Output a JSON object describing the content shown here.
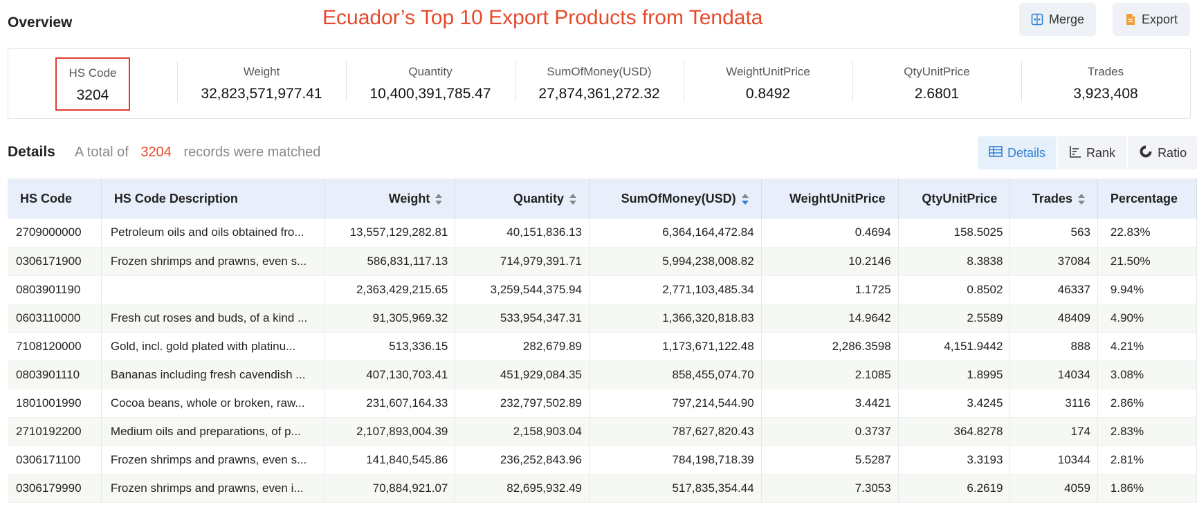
{
  "header": {
    "overview_title": "Overview",
    "banner": "Ecuador’s Top 10 Export Products from Tendata",
    "merge_label": "Merge",
    "export_label": "Export"
  },
  "summary": [
    {
      "label": "HS Code",
      "value": "3204"
    },
    {
      "label": "Weight",
      "value": "32,823,571,977.41"
    },
    {
      "label": "Quantity",
      "value": "10,400,391,785.47"
    },
    {
      "label": "SumOfMoney(USD)",
      "value": "27,874,361,272.32"
    },
    {
      "label": "WeightUnitPrice",
      "value": "0.8492"
    },
    {
      "label": "QtyUnitPrice",
      "value": "2.6801"
    },
    {
      "label": "Trades",
      "value": "3,923,408"
    }
  ],
  "details": {
    "title": "Details",
    "prefix": "A total of",
    "count": "3204",
    "suffix": "records were matched"
  },
  "tabs": [
    {
      "label": "Details",
      "icon": "table-icon",
      "active": true
    },
    {
      "label": "Rank",
      "icon": "rank-icon",
      "active": false
    },
    {
      "label": "Ratio",
      "icon": "ratio-icon",
      "active": false
    }
  ],
  "table": {
    "columns": [
      "HS Code",
      "HS Code Description",
      "Weight",
      "Quantity",
      "SumOfMoney(USD)",
      "WeightUnitPrice",
      "QtyUnitPrice",
      "Trades",
      "Percentage"
    ],
    "rows": [
      [
        "2709000000",
        "Petroleum oils and oils obtained fro...",
        "13,557,129,282.81",
        "40,151,836.13",
        "6,364,164,472.84",
        "0.4694",
        "158.5025",
        "563",
        "22.83%"
      ],
      [
        "0306171900",
        "Frozen shrimps and prawns, even s...",
        "586,831,117.13",
        "714,979,391.71",
        "5,994,238,008.82",
        "10.2146",
        "8.3838",
        "37084",
        "21.50%"
      ],
      [
        "0803901190",
        "",
        "2,363,429,215.65",
        "3,259,544,375.94",
        "2,771,103,485.34",
        "1.1725",
        "0.8502",
        "46337",
        "9.94%"
      ],
      [
        "0603110000",
        "Fresh cut roses and buds, of a kind ...",
        "91,305,969.32",
        "533,954,347.31",
        "1,366,320,818.83",
        "14.9642",
        "2.5589",
        "48409",
        "4.90%"
      ],
      [
        "7108120000",
        "Gold, incl. gold plated with platinu...",
        "513,336.15",
        "282,679.89",
        "1,173,671,122.48",
        "2,286.3598",
        "4,151.9442",
        "888",
        "4.21%"
      ],
      [
        "0803901110",
        "Bananas including fresh cavendish ...",
        "407,130,703.41",
        "451,929,084.35",
        "858,455,074.70",
        "2.1085",
        "1.8995",
        "14034",
        "3.08%"
      ],
      [
        "1801001990",
        "Cocoa beans, whole or broken, raw...",
        "231,607,164.33",
        "232,797,502.89",
        "797,214,544.90",
        "3.4421",
        "3.4245",
        "3116",
        "2.86%"
      ],
      [
        "2710192200",
        "Medium oils and preparations, of p...",
        "2,107,893,004.39",
        "2,158,903.04",
        "787,627,820.43",
        "0.3737",
        "364.8278",
        "174",
        "2.83%"
      ],
      [
        "0306171100",
        "Frozen shrimps and prawns, even s...",
        "141,840,545.86",
        "236,252,843.96",
        "784,198,718.39",
        "5.5287",
        "3.3193",
        "10344",
        "2.81%"
      ],
      [
        "0306179990",
        "Frozen shrimps and prawns, even i...",
        "70,884,921.07",
        "82,695,932.49",
        "517,835,354.44",
        "7.3053",
        "6.2619",
        "4059",
        "1.86%"
      ]
    ]
  },
  "colors": {
    "accent": "#2d7fd6",
    "highlight": "#e8492b",
    "box": "#e53935"
  }
}
